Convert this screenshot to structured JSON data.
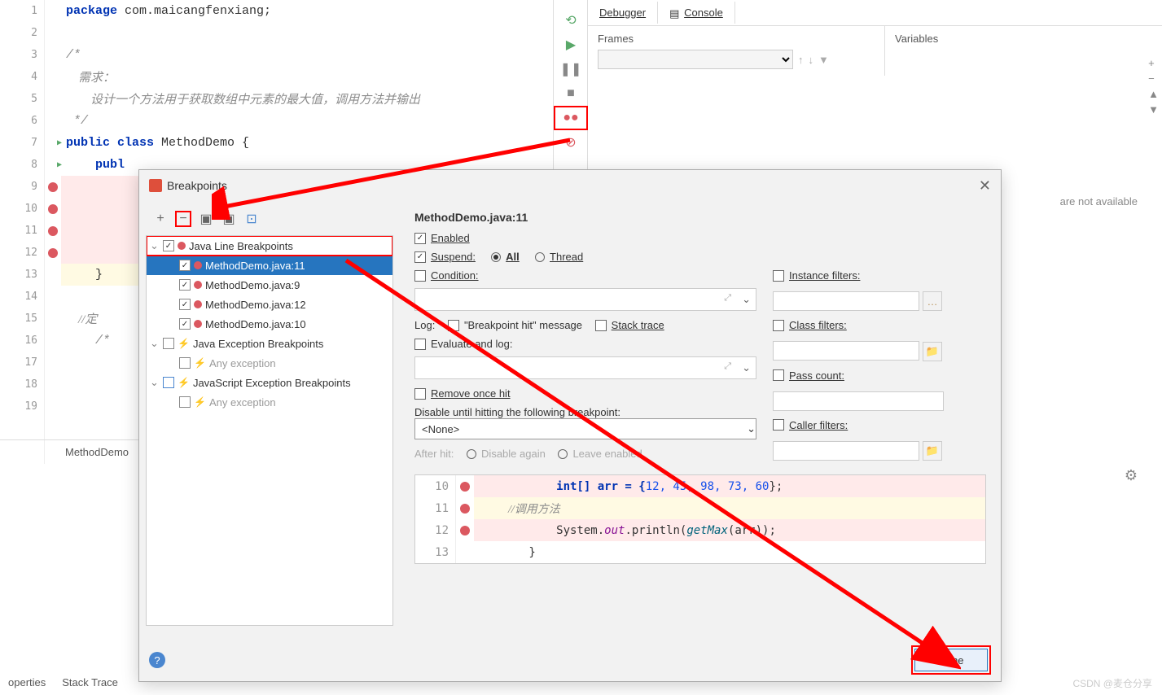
{
  "editor": {
    "lines": [
      "1",
      "2",
      "3",
      "4",
      "5",
      "6",
      "7",
      "8",
      "9",
      "10",
      "11",
      "12",
      "13",
      "14",
      "15",
      "16",
      "17",
      "18",
      "19"
    ],
    "package_kw": "package ",
    "package_name": "com.maicangfenxiang;",
    "comment_open": "/*",
    "comment_l1": "    需求：",
    "comment_l2": "        设计一个方法用于获取数组中元素的最大值，调用方法并输出",
    "comment_close": " */",
    "class_kw": "public class ",
    "class_name": "MethodDemo {",
    "main_kw": "    publ",
    "brace": "    }",
    "c1": "    //定",
    "c2": "    /*"
  },
  "tab": {
    "name": "MethodDemo"
  },
  "debug": {
    "tab1": "Debugger",
    "tab2": "Console",
    "frames": "Frames",
    "variables": "Variables",
    "not_avail": "are not available"
  },
  "dialog": {
    "title": "Breakpoints",
    "detail_title": "MethodDemo.java:11",
    "tree": {
      "root1": "Java Line Breakpoints",
      "items": [
        "MethodDemo.java:11",
        "MethodDemo.java:9",
        "MethodDemo.java:12",
        "MethodDemo.java:10"
      ],
      "root2": "Java Exception Breakpoints",
      "any1": "Any exception",
      "root3": "JavaScript Exception Breakpoints",
      "any2": "Any exception"
    },
    "opts": {
      "enabled": "Enabled",
      "suspend": "Suspend:",
      "all": "All",
      "thread": "Thread",
      "condition": "Condition:",
      "log": "Log:",
      "bphit": "\"Breakpoint hit\" message",
      "stack": "Stack trace",
      "eval": "Evaluate and log:",
      "remove": "Remove once hit",
      "disable_until": "Disable until hitting the following breakpoint:",
      "none": "<None>",
      "after_hit": "After hit:",
      "disable_again": "Disable again",
      "leave": "Leave enabled",
      "instance": "Instance filters:",
      "class": "Class filters:",
      "pass": "Pass count:",
      "caller": "Caller filters:"
    },
    "preview": {
      "l10": "10",
      "l11": "11",
      "l12": "12",
      "l13": "13",
      "c10a": "            int[] arr = {",
      "c10b": "12, 45, 98, 73, 60",
      "c10c": "};",
      "c11": "            //调用方法",
      "c12a": "            System.",
      "c12b": "out",
      "c12c": ".println(",
      "c12d": "getMax",
      "c12e": "(arr));",
      "c13": "        }"
    },
    "done": "Done"
  },
  "bottom": {
    "props": "operties",
    "stack": "Stack Trace"
  },
  "watermark": "CSDN @麦仓分享"
}
